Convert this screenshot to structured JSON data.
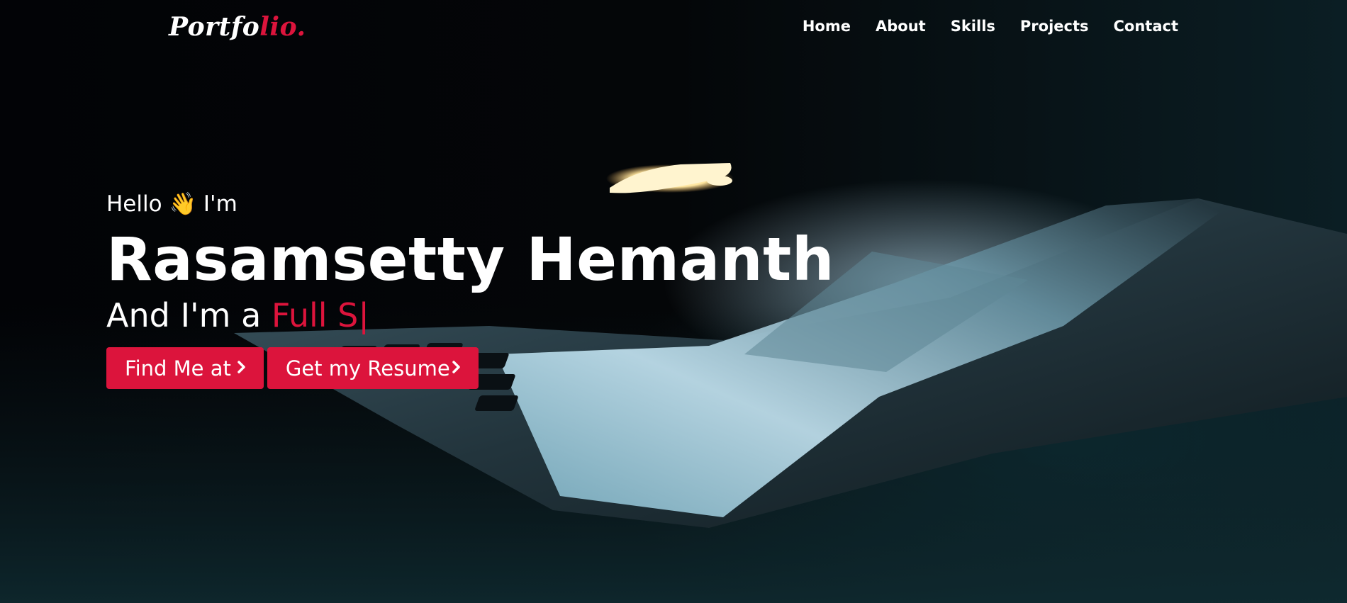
{
  "brand": {
    "logo_primary": "Portfo",
    "logo_accent": "lio.",
    "accent_color": "#dc143c"
  },
  "nav": {
    "items": [
      {
        "label": "Home"
      },
      {
        "label": "About"
      },
      {
        "label": "Skills"
      },
      {
        "label": "Projects"
      },
      {
        "label": "Contact"
      }
    ]
  },
  "hero": {
    "greeting_before": "Hello",
    "wave_emoji": "👋",
    "greeting_after": "I'm",
    "name": "Rasamsetty Hemanth",
    "tagline_prefix": "And I'm a",
    "typed_text": "Full S",
    "cursor": "|",
    "buttons": {
      "find_me": {
        "label": "Find Me at",
        "icon": "chevron-right-icon"
      },
      "resume": {
        "label": "Get my Resume",
        "icon": "chevron-right-icon"
      }
    }
  }
}
